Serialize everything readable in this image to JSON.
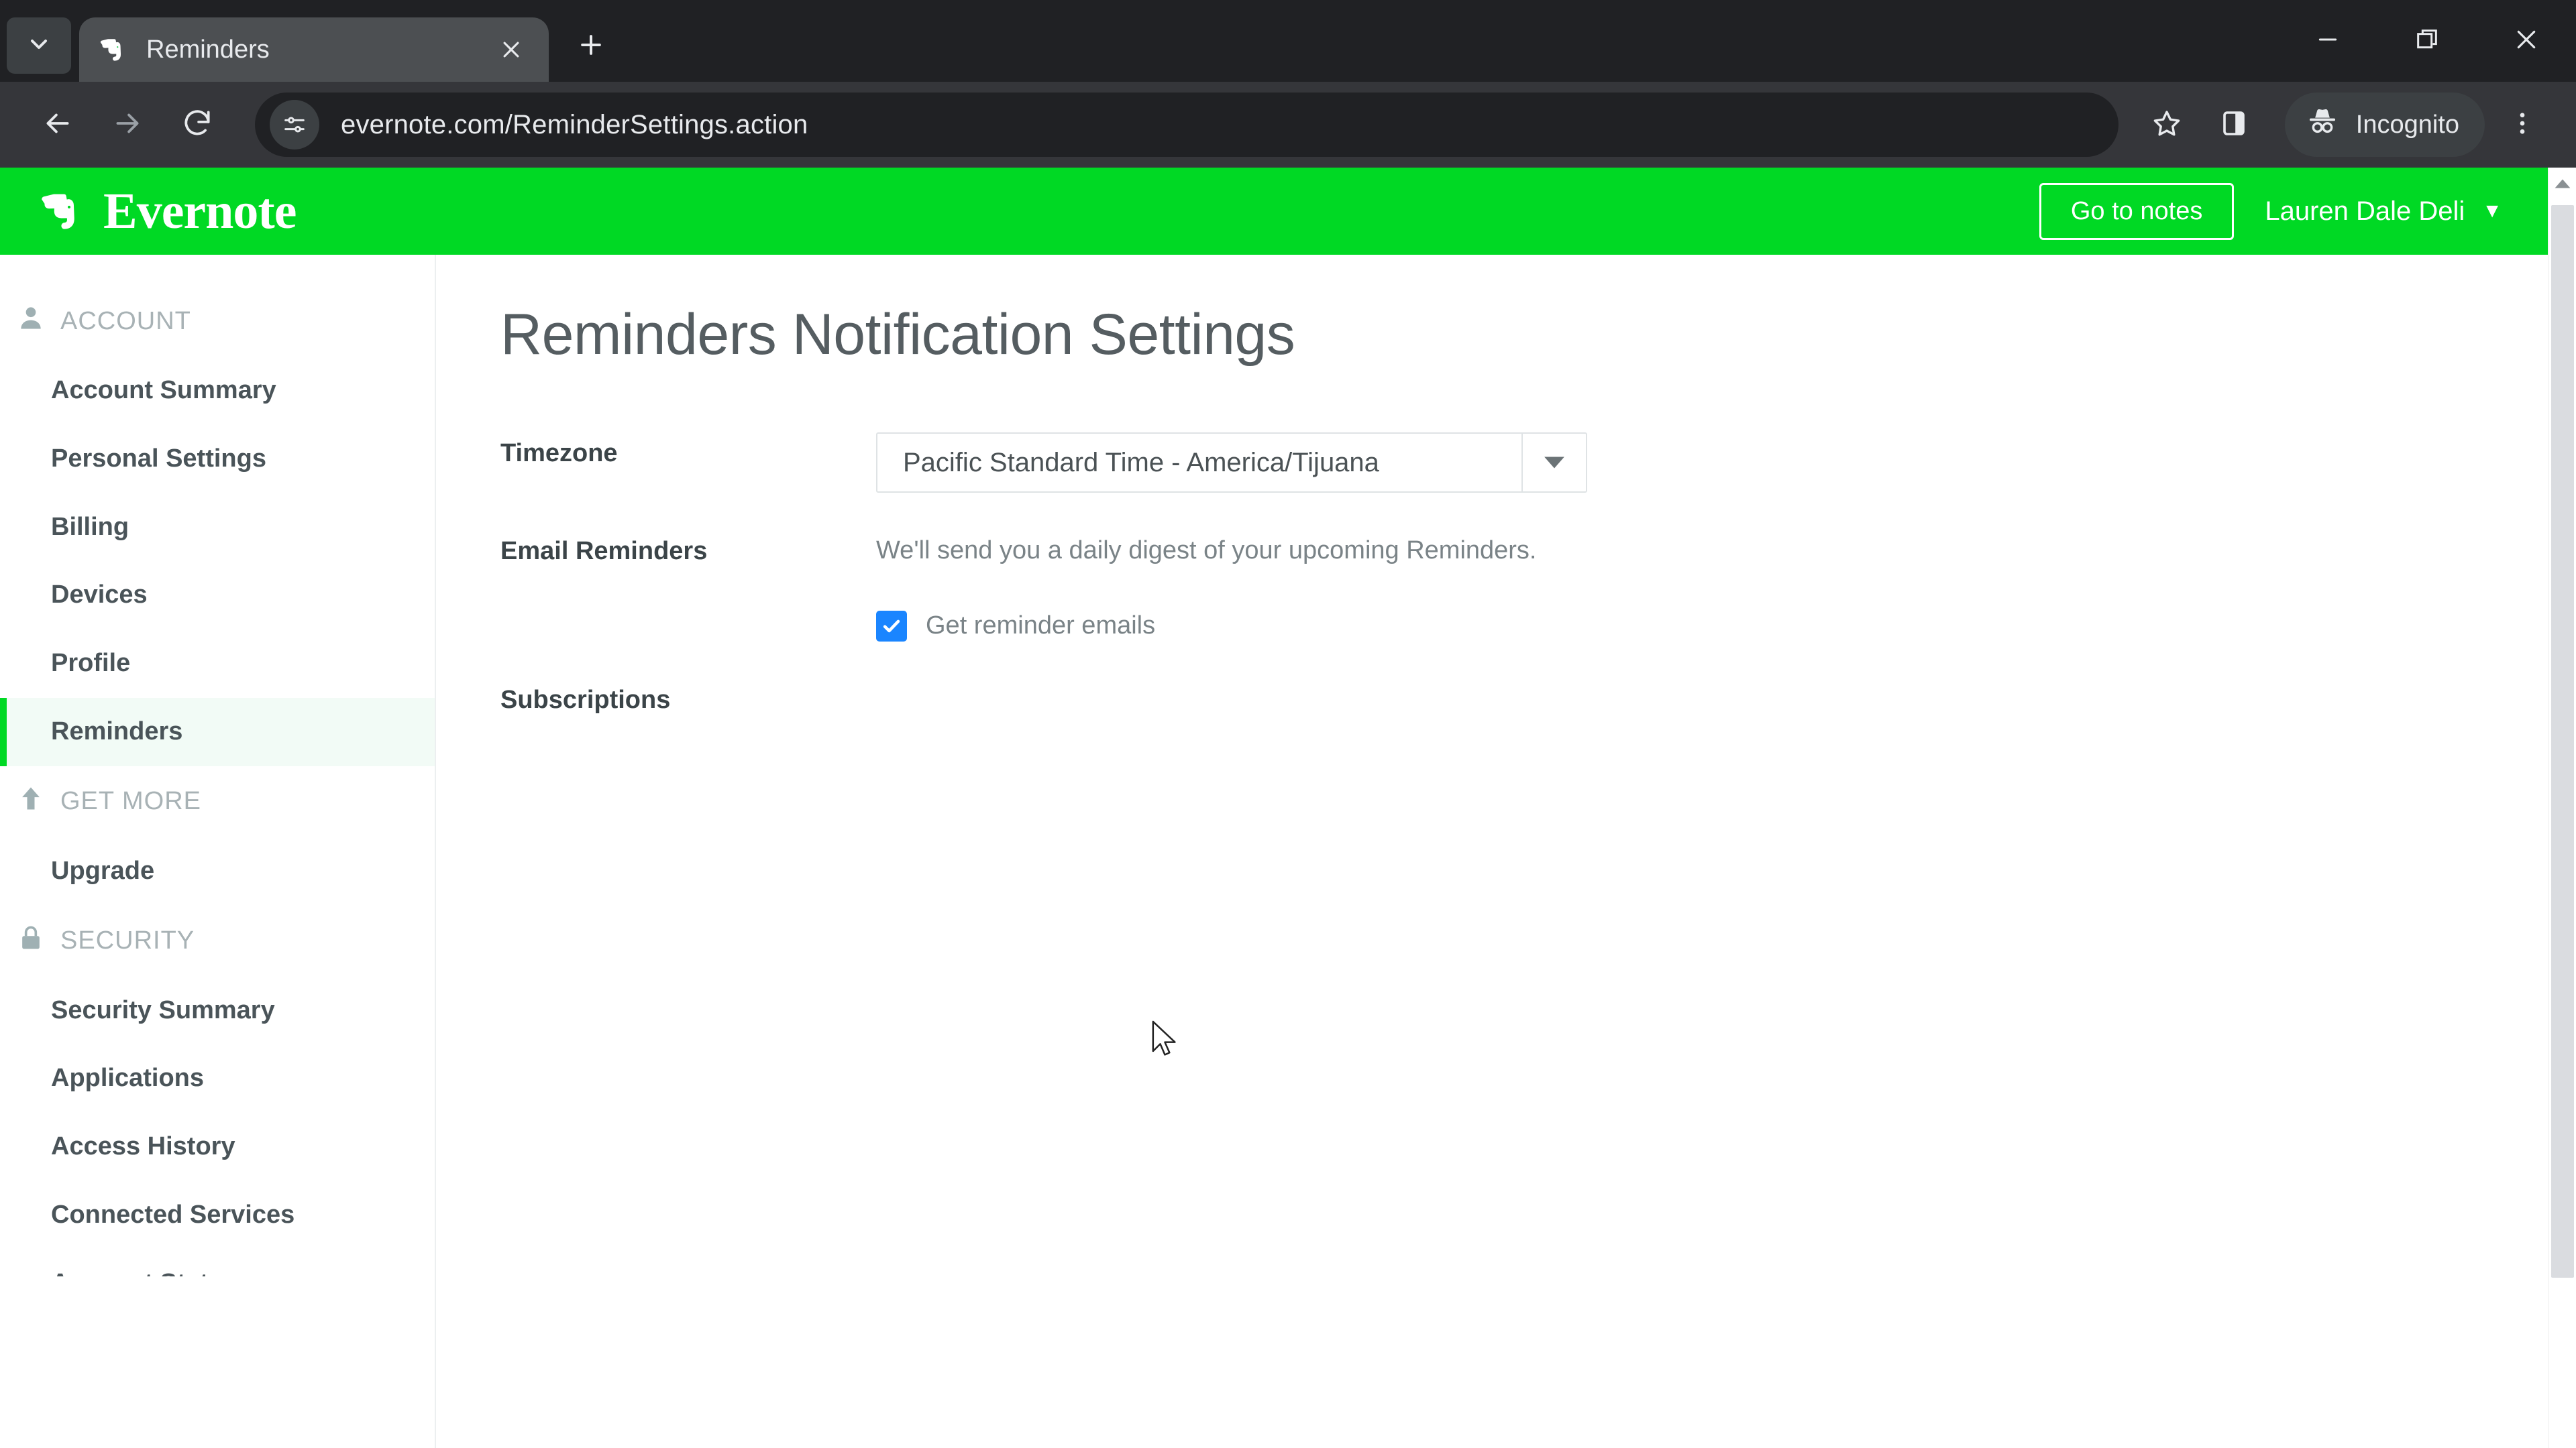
{
  "browser": {
    "tab_search_icon": "chevron-down-icon",
    "tab": {
      "title": "Reminders",
      "favicon": "evernote-elephant-favicon",
      "close_icon": "close-icon"
    },
    "new_tab_label": "+",
    "window_controls": {
      "minimize": "minimize-icon",
      "maximize": "restore-icon",
      "close": "close-icon"
    },
    "nav": {
      "back": "back-arrow-icon",
      "forward": "forward-arrow-icon",
      "reload": "reload-icon"
    },
    "omnibox": {
      "site_settings_icon": "tune-icon",
      "url": "evernote.com/ReminderSettings.action"
    },
    "actions": {
      "bookmark_icon": "star-icon",
      "side_panel_icon": "side-panel-icon",
      "incognito_label": "Incognito",
      "incognito_icon": "incognito-hat-icon",
      "menu_icon": "three-dot-menu-icon"
    }
  },
  "app": {
    "brand": "Evernote",
    "brand_icon": "evernote-elephant-logo",
    "accent_green": "#00d924",
    "header": {
      "go_to_notes": "Go to notes",
      "account_name": "Lauren Dale Deli",
      "caret": "▼"
    }
  },
  "sidebar": {
    "sections": [
      {
        "title": "ACCOUNT",
        "icon": "person-icon",
        "items": [
          {
            "label": "Account Summary",
            "active": false
          },
          {
            "label": "Personal Settings",
            "active": false
          },
          {
            "label": "Billing",
            "active": false
          },
          {
            "label": "Devices",
            "active": false
          },
          {
            "label": "Profile",
            "active": false
          },
          {
            "label": "Reminders",
            "active": true
          }
        ]
      },
      {
        "title": "GET MORE",
        "icon": "up-arrow-icon",
        "items": [
          {
            "label": "Upgrade",
            "active": false
          }
        ]
      },
      {
        "title": "SECURITY",
        "icon": "lock-icon",
        "items": [
          {
            "label": "Security Summary",
            "active": false
          },
          {
            "label": "Applications",
            "active": false
          },
          {
            "label": "Access History",
            "active": false
          },
          {
            "label": "Connected Services",
            "active": false
          },
          {
            "label": "Account Status",
            "active": false,
            "clipped": true
          }
        ]
      }
    ]
  },
  "main": {
    "page_title": "Reminders Notification Settings",
    "rows": {
      "timezone": {
        "label": "Timezone",
        "selected": "Pacific Standard Time - America/Tijuana",
        "caret_icon": "caret-down-icon"
      },
      "email_reminders": {
        "label": "Email Reminders",
        "description": "We'll send you a daily digest of your upcoming Reminders.",
        "checkbox_label": "Get reminder emails",
        "checkbox_checked": true,
        "checkbox_color": "#1a85ff"
      },
      "subscriptions": {
        "label": "Subscriptions"
      }
    }
  },
  "scrollbar": {
    "up_arrow_icon": "scroll-up-arrow-icon"
  },
  "cursor": {
    "icon": "mouse-pointer-icon"
  }
}
